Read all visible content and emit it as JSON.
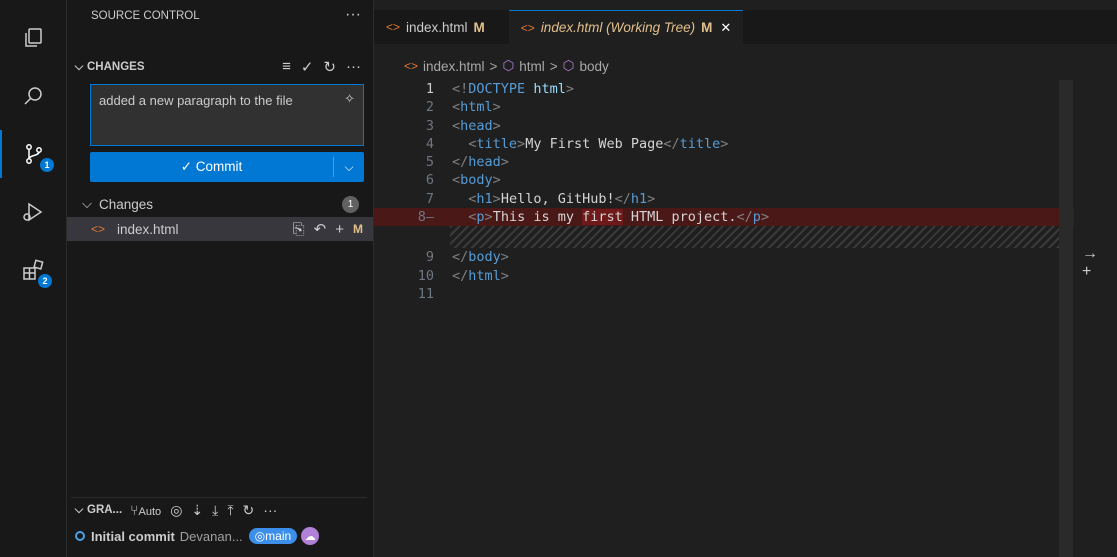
{
  "activity_bar": {
    "scm_badge": "1",
    "extensions_badge": "2"
  },
  "sidebar": {
    "title": "SOURCE CONTROL",
    "more": "···",
    "changes_section": "CHANGES",
    "commit_message": "added a new paragraph to the file",
    "commit_button": "✓ Commit",
    "changes_group": "Changes",
    "changes_count": "1",
    "file": {
      "name": "index.html",
      "status": "M"
    },
    "graph": {
      "title": "GRA...",
      "auto": "Auto",
      "commit_title": "Initial commit",
      "commit_author": "Devanan...",
      "branch": "main"
    }
  },
  "editor": {
    "tabs": [
      {
        "label": "index.html",
        "status": "M"
      },
      {
        "label": "index.html (Working Tree)",
        "status": "M"
      }
    ],
    "breadcrumb": [
      "index.html",
      "html",
      "body"
    ],
    "line_numbers": [
      "1",
      "2",
      "3",
      "4",
      "5",
      "6",
      "7",
      "8",
      "",
      "9",
      "10",
      "11"
    ]
  },
  "colors": {
    "accent": "#0078d4",
    "modified": "#e2c08d",
    "deleted_bg": "#4b1818"
  }
}
